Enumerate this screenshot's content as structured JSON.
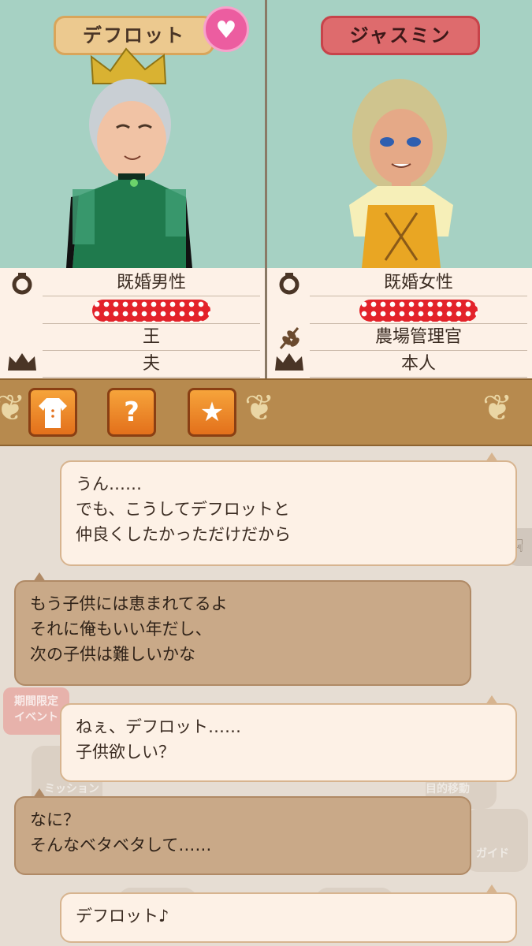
{
  "characters": {
    "left": {
      "name": "デフロット",
      "rows": [
        "既婚男性",
        "",
        "王",
        "夫"
      ],
      "icons": [
        "ring-icon",
        "",
        "",
        "crown-icon"
      ]
    },
    "right": {
      "name": "ジャスミン",
      "rows": [
        "既婚女性",
        "",
        "農場管理官",
        "本人"
      ],
      "icons": [
        "ring-icon",
        "",
        "wheat-icon",
        "crown-icon"
      ]
    }
  },
  "toolbar": {
    "buttons": [
      "outfit-icon",
      "question-icon",
      "star-icon"
    ]
  },
  "chat": {
    "messages": [
      {
        "side": "right",
        "lines": [
          "うん……",
          "でも、こうしてデフロットと",
          "仲良くしたかっただけだから"
        ]
      },
      {
        "side": "left",
        "lines": [
          "もう子供には恵まれてるよ",
          "それに俺もいい年だし、",
          "次の子供は難しいかな"
        ]
      },
      {
        "side": "right",
        "lines": [
          "ねぇ、デフロット……",
          "子供欲しい？"
        ]
      },
      {
        "side": "left",
        "lines": [
          "なに？",
          "そんなベタベタして……"
        ]
      },
      {
        "side": "right",
        "lines": [
          "デフロット♪"
        ]
      }
    ],
    "background": {
      "event_badge": [
        "期間限定",
        "イベント"
      ],
      "labels": [
        "ミッション",
        "目的移動",
        "ガイド"
      ]
    }
  },
  "colors": {
    "panel_bg": "#a6d1c3",
    "male_tag": "#ecc98f",
    "female_tag": "#de6b6d",
    "toolbar": "#b78a4e",
    "heart": "#ec5da0"
  }
}
